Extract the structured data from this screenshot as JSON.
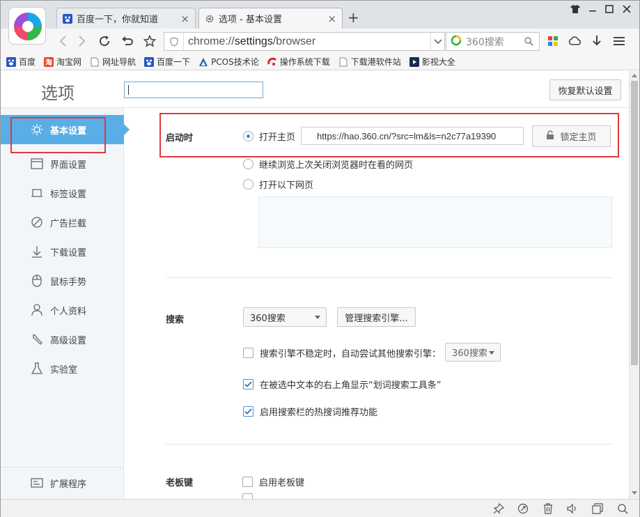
{
  "tabs": [
    {
      "label": "百度一下，你就知道",
      "icon": "baidu-paw-icon",
      "active": false
    },
    {
      "label": "选项 - 基本设置",
      "icon": "gear-icon",
      "active": true
    }
  ],
  "address": {
    "prefix": "chrome://",
    "host": "settings",
    "path": "/browser"
  },
  "search_engine": {
    "placeholder": "360搜索"
  },
  "bookmarks": [
    {
      "label": "百度",
      "icon": "baidu-paw-icon"
    },
    {
      "label": "淘宝网",
      "icon": "taobao-icon"
    },
    {
      "label": "网址导航",
      "icon": "page-icon"
    },
    {
      "label": "百度一下",
      "icon": "baidu-paw-icon"
    },
    {
      "label": "PCOS技术论",
      "icon": "pcos-icon"
    },
    {
      "label": "操作系统下载",
      "icon": "os-download-icon"
    },
    {
      "label": "下载港软件站",
      "icon": "page-icon"
    },
    {
      "label": "影视大全",
      "icon": "film-icon"
    }
  ],
  "page": {
    "title": "选项",
    "search_value": "",
    "restore_button": "恢复默认设置"
  },
  "sidebar": {
    "items": [
      {
        "label": "基本设置",
        "icon": "sun-gear-icon",
        "active": true
      },
      {
        "label": "界面设置",
        "icon": "window-icon"
      },
      {
        "label": "标签设置",
        "icon": "tab-icon"
      },
      {
        "label": "广告拦截",
        "icon": "block-icon"
      },
      {
        "label": "下载设置",
        "icon": "download-icon"
      },
      {
        "label": "鼠标手势",
        "icon": "mouse-icon"
      },
      {
        "label": "个人资料",
        "icon": "user-icon"
      },
      {
        "label": "高级设置",
        "icon": "wrench-icon"
      },
      {
        "label": "实验室",
        "icon": "flask-icon"
      }
    ],
    "footer": {
      "label": "扩展程序",
      "icon": "extension-icon"
    }
  },
  "startup": {
    "label": "启动时",
    "options": [
      {
        "label": "打开主页",
        "selected": true
      },
      {
        "label": "继续浏览上次关闭浏览器时在看的网页",
        "selected": false
      },
      {
        "label": "打开以下网页",
        "selected": false
      }
    ],
    "homepage_url": "https://hao.360.cn/?src=lm&ls=n2c77a19390",
    "lock_button": "锁定主页"
  },
  "search": {
    "label": "搜索",
    "engine_select": "360搜索",
    "manage_button": "管理搜索引擎...",
    "options": [
      {
        "label": "搜索引擎不稳定时，自动尝试其他搜索引擎：",
        "checked": false,
        "select": "360搜索"
      },
      {
        "label": "在被选中文本的右上角显示“划词搜索工具条”",
        "checked": true
      },
      {
        "label": "启用搜索栏的热搜词推荐功能",
        "checked": true
      }
    ]
  },
  "boss_key": {
    "label": "老板键",
    "options": [
      {
        "label": "启用老板键",
        "checked": false
      }
    ]
  },
  "colors": {
    "accent": "#5aaee6",
    "highlight_box": "#e0393e",
    "check_blue": "#3d8be0"
  }
}
